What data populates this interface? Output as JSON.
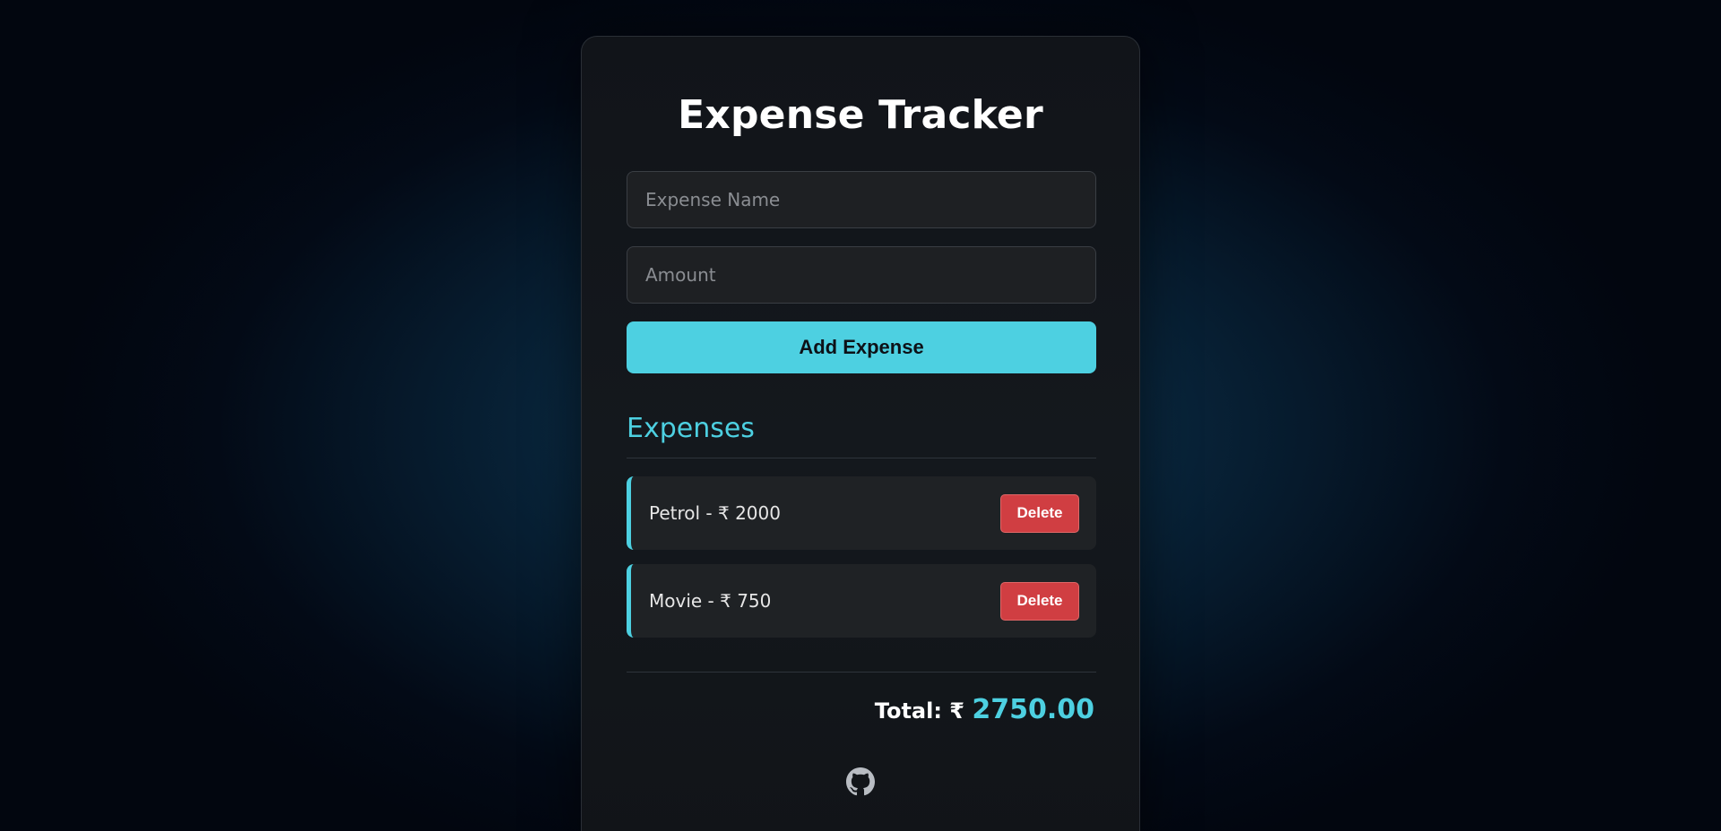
{
  "app": {
    "title": "Expense Tracker"
  },
  "form": {
    "name_placeholder": "Expense Name",
    "name_value": "",
    "amount_placeholder": "Amount",
    "amount_value": "",
    "add_label": "Add Expense"
  },
  "expenses": {
    "heading": "Expenses",
    "items": [
      {
        "text": "Petrol - ₹ 2000",
        "delete_label": "Delete"
      },
      {
        "text": "Movie - ₹ 750",
        "delete_label": "Delete"
      }
    ]
  },
  "total": {
    "label": "Total: ₹ ",
    "value": "2750.00"
  },
  "footer": {
    "icon": "github-icon"
  },
  "colors": {
    "accent": "#4dd0e1",
    "danger": "#d03e42",
    "card_bg": "#14181d"
  }
}
